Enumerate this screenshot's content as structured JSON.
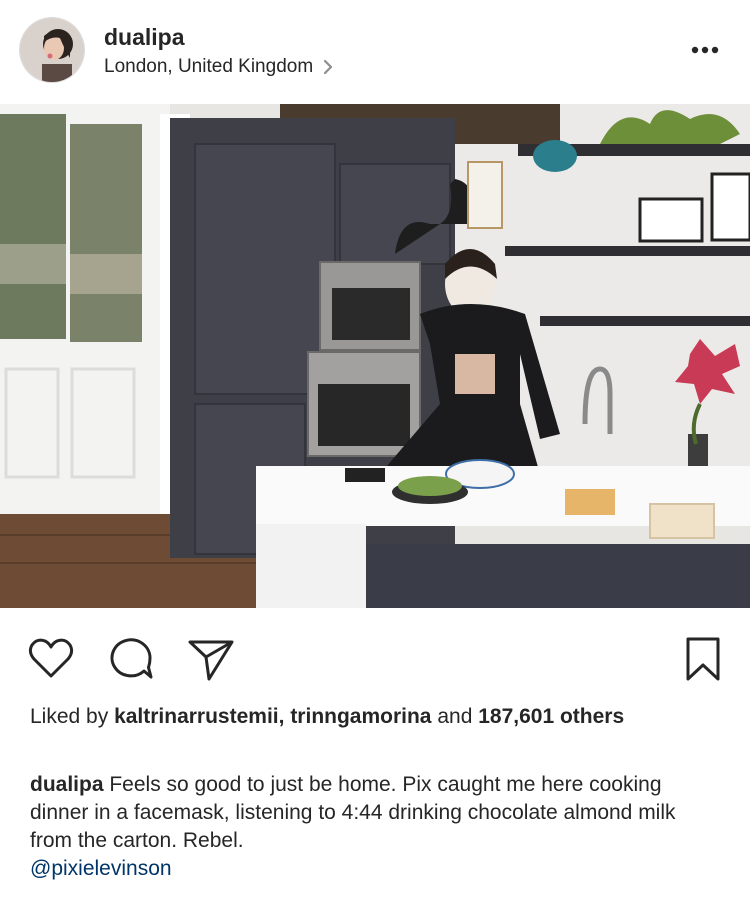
{
  "post": {
    "username": "dualipa",
    "location": "London, United Kingdom",
    "likes": {
      "prefix": "Liked by ",
      "user1": "kaltrinarrustemii",
      "sep": ", ",
      "user2": "trinngamorina",
      "and": " and ",
      "count": "187,601",
      "others": "others"
    },
    "caption": {
      "username": "dualipa",
      "text": " Feels so good to just be home. Pix caught me here cooking dinner in a facemask, listening to 4:44 drinking chocolate almond milk from the carton. Rebel.",
      "mention": "@pixielevinson"
    }
  },
  "icons": {
    "more": "more-horizontal-icon",
    "like": "heart-icon",
    "comment": "comment-icon",
    "share": "paper-plane-icon",
    "save": "bookmark-icon",
    "location_chevron": "chevron-right-icon"
  }
}
